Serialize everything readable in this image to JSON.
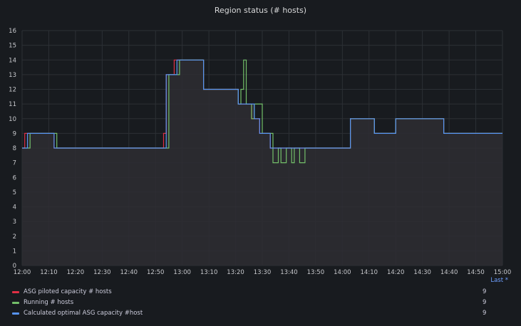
{
  "panel": {
    "title": "Region status (# hosts)",
    "legend_header": "Last *"
  },
  "chart_data": {
    "type": "area",
    "title": "Region status (# hosts)",
    "xlabel": "",
    "ylabel": "",
    "ylim": [
      0,
      16
    ],
    "yticks": [
      "0",
      "1",
      "2",
      "3",
      "4",
      "5",
      "6",
      "7",
      "8",
      "9",
      "10",
      "11",
      "12",
      "13",
      "14",
      "15",
      "16"
    ],
    "xlim": [
      "12:00",
      "15:00"
    ],
    "xticks": [
      "12:00",
      "12:10",
      "12:20",
      "12:30",
      "12:40",
      "12:50",
      "13:00",
      "13:10",
      "13:20",
      "13:30",
      "13:40",
      "13:50",
      "14:00",
      "14:10",
      "14:20",
      "14:30",
      "14:40",
      "14:50",
      "15:00"
    ],
    "grid": true,
    "legend_position": "bottom",
    "fill_color": "#2e2d33",
    "series": [
      {
        "name": "ASG piloted capacity # hosts",
        "color": "#e02f44",
        "last": "9",
        "points": [
          [
            "12:00",
            8
          ],
          [
            "12:01",
            8
          ],
          [
            "12:01",
            9
          ],
          [
            "12:12",
            9
          ],
          [
            "12:12",
            8
          ],
          [
            "12:53",
            8
          ],
          [
            "12:53",
            9
          ],
          [
            "12:54",
            9
          ],
          [
            "12:54",
            13
          ],
          [
            "12:57",
            13
          ],
          [
            "12:57",
            14
          ],
          [
            "13:08",
            14
          ],
          [
            "13:08",
            12
          ],
          [
            "13:21",
            12
          ],
          [
            "13:21",
            11
          ],
          [
            "13:26",
            11
          ],
          [
            "13:26",
            10
          ],
          [
            "13:29",
            10
          ],
          [
            "13:29",
            9
          ],
          [
            "13:33",
            9
          ],
          [
            "13:33",
            8
          ],
          [
            "14:03",
            8
          ],
          [
            "14:03",
            10
          ],
          [
            "14:12",
            10
          ],
          [
            "14:12",
            9
          ],
          [
            "14:20",
            9
          ],
          [
            "14:20",
            10
          ],
          [
            "14:38",
            10
          ],
          [
            "14:38",
            9
          ],
          [
            "15:00",
            9
          ]
        ]
      },
      {
        "name": "Running # hosts",
        "color": "#73bf69",
        "last": "9",
        "points": [
          [
            "12:00",
            8
          ],
          [
            "12:03",
            8
          ],
          [
            "12:03",
            9
          ],
          [
            "12:13",
            9
          ],
          [
            "12:13",
            8
          ],
          [
            "12:55",
            8
          ],
          [
            "12:55",
            13
          ],
          [
            "12:59",
            13
          ],
          [
            "12:59",
            14
          ],
          [
            "13:08",
            14
          ],
          [
            "13:08",
            12
          ],
          [
            "13:21",
            12
          ],
          [
            "13:21",
            11
          ],
          [
            "13:22",
            11
          ],
          [
            "13:22",
            12
          ],
          [
            "13:23",
            12
          ],
          [
            "13:23",
            14
          ],
          [
            "13:24",
            14
          ],
          [
            "13:24",
            11
          ],
          [
            "13:26",
            11
          ],
          [
            "13:26",
            10
          ],
          [
            "13:27",
            10
          ],
          [
            "13:27",
            11
          ],
          [
            "13:30",
            11
          ],
          [
            "13:30",
            9
          ],
          [
            "13:34",
            9
          ],
          [
            "13:34",
            7
          ],
          [
            "13:36",
            7
          ],
          [
            "13:36",
            8
          ],
          [
            "13:37",
            8
          ],
          [
            "13:37",
            7
          ],
          [
            "13:39",
            7
          ],
          [
            "13:39",
            8
          ],
          [
            "13:41",
            8
          ],
          [
            "13:41",
            7
          ],
          [
            "13:42",
            7
          ],
          [
            "13:42",
            8
          ],
          [
            "13:44",
            8
          ],
          [
            "13:44",
            7
          ],
          [
            "13:46",
            7
          ],
          [
            "13:46",
            8
          ],
          [
            "14:03",
            8
          ],
          [
            "14:03",
            10
          ],
          [
            "14:12",
            10
          ],
          [
            "14:12",
            9
          ],
          [
            "14:20",
            9
          ],
          [
            "14:20",
            10
          ],
          [
            "14:38",
            10
          ],
          [
            "14:38",
            9
          ],
          [
            "15:00",
            9
          ]
        ]
      },
      {
        "name": "Calculated optimal ASG capacity #host",
        "color": "#5794f2",
        "last": "9",
        "points": [
          [
            "12:00",
            8
          ],
          [
            "12:02",
            8
          ],
          [
            "12:02",
            9
          ],
          [
            "12:12",
            9
          ],
          [
            "12:12",
            8
          ],
          [
            "12:54",
            8
          ],
          [
            "12:54",
            13
          ],
          [
            "12:58",
            13
          ],
          [
            "12:58",
            14
          ],
          [
            "13:08",
            14
          ],
          [
            "13:08",
            12
          ],
          [
            "13:21",
            12
          ],
          [
            "13:21",
            11
          ],
          [
            "13:27",
            11
          ],
          [
            "13:27",
            10
          ],
          [
            "13:29",
            10
          ],
          [
            "13:29",
            9
          ],
          [
            "13:33",
            9
          ],
          [
            "13:33",
            8
          ],
          [
            "14:03",
            8
          ],
          [
            "14:03",
            10
          ],
          [
            "14:12",
            10
          ],
          [
            "14:12",
            9
          ],
          [
            "14:20",
            9
          ],
          [
            "14:20",
            10
          ],
          [
            "14:38",
            10
          ],
          [
            "14:38",
            9
          ],
          [
            "15:00",
            9
          ]
        ]
      }
    ]
  }
}
